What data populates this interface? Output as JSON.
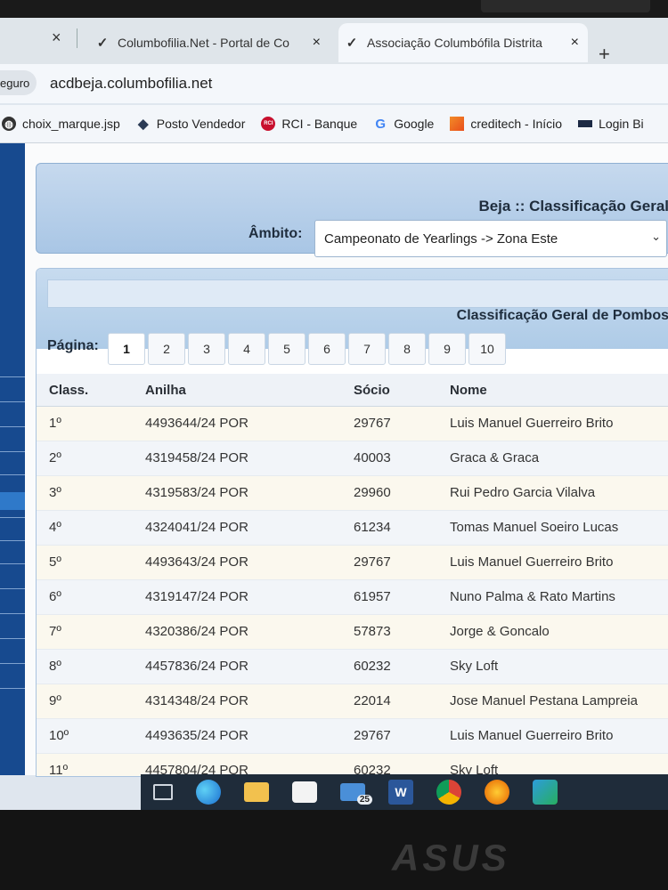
{
  "browser": {
    "tabs": [
      {
        "title": "Columbofilia.Net - Portal de Co",
        "active": false
      },
      {
        "title": "Associação Columbófila Distrita",
        "active": true
      }
    ],
    "new_tab_label": "+",
    "close_label": "×",
    "secure_label": "eguro",
    "url": "acdbeja.columbofilia.net"
  },
  "bookmarks": [
    {
      "label": "choix_marque.jsp",
      "icon": "globe-icon"
    },
    {
      "label": "Posto Vendedor",
      "icon": "diamond-icon"
    },
    {
      "label": "RCI - Banque",
      "icon": "rci-icon"
    },
    {
      "label": "Google",
      "icon": "google-icon"
    },
    {
      "label": "creditech - Início",
      "icon": "creditech-icon"
    },
    {
      "label": "Login Bi",
      "icon": "login-icon"
    }
  ],
  "header": {
    "title": "Beja :: Classificação Geral",
    "ambito_label": "Âmbito:",
    "ambito_value": "Campeonato de Yearlings -> Zona Este"
  },
  "classification": {
    "title": "Classificação Geral de Pombos",
    "pagina_label": "Página:",
    "pages": [
      "1",
      "2",
      "3",
      "4",
      "5",
      "6",
      "7",
      "8",
      "9",
      "10"
    ],
    "active_page": "1",
    "columns": [
      "Class.",
      "Anilha",
      "Sócio",
      "Nome"
    ],
    "rows": [
      {
        "class": "1º",
        "anilha": "4493644/24 POR",
        "socio": "29767",
        "nome": "Luis Manuel Guerreiro Brito"
      },
      {
        "class": "2º",
        "anilha": "4319458/24 POR",
        "socio": "40003",
        "nome": "Graca & Graca"
      },
      {
        "class": "3º",
        "anilha": "4319583/24 POR",
        "socio": "29960",
        "nome": "Rui Pedro Garcia Vilalva"
      },
      {
        "class": "4º",
        "anilha": "4324041/24 POR",
        "socio": "61234",
        "nome": "Tomas Manuel Soeiro Lucas"
      },
      {
        "class": "5º",
        "anilha": "4493643/24 POR",
        "socio": "29767",
        "nome": "Luis Manuel Guerreiro Brito"
      },
      {
        "class": "6º",
        "anilha": "4319147/24 POR",
        "socio": "61957",
        "nome": "Nuno Palma & Rato Martins"
      },
      {
        "class": "7º",
        "anilha": "4320386/24 POR",
        "socio": "57873",
        "nome": "Jorge & Goncalo"
      },
      {
        "class": "8º",
        "anilha": "4457836/24 POR",
        "socio": "60232",
        "nome": "Sky Loft"
      },
      {
        "class": "9º",
        "anilha": "4314348/24 POR",
        "socio": "22014",
        "nome": "Jose Manuel Pestana Lampreia"
      },
      {
        "class": "10º",
        "anilha": "4493635/24 POR",
        "socio": "29767",
        "nome": "Luis Manuel Guerreiro Brito"
      },
      {
        "class": "11º",
        "anilha": "4457804/24 POR",
        "socio": "60232",
        "nome": "Sky Loft"
      }
    ]
  },
  "taskbar": {
    "mail_badge": "25",
    "word_label": "W"
  },
  "device_brand": "ASUS"
}
